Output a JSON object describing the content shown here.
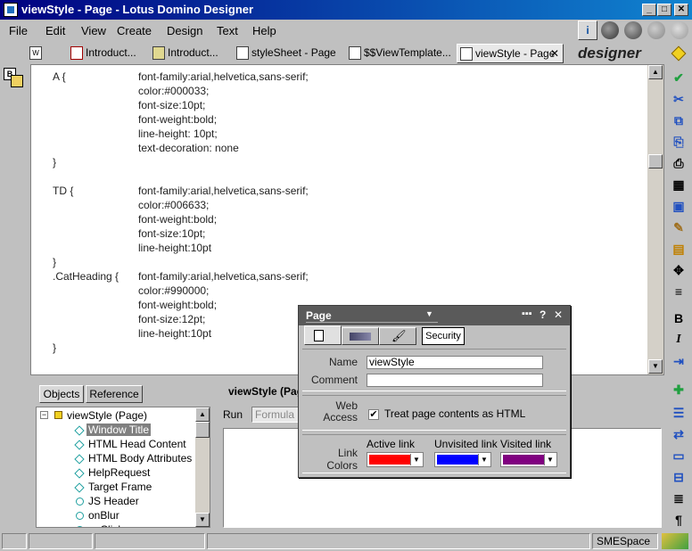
{
  "window": {
    "title": "viewStyle - Page - Lotus Domino Designer"
  },
  "menu": [
    "File",
    "Edit",
    "View",
    "Create",
    "Design",
    "Text",
    "Help"
  ],
  "tabs": [
    {
      "label": "Introduct..."
    },
    {
      "label": "Introduct..."
    },
    {
      "label": "styleSheet - Page"
    },
    {
      "label": "$$ViewTemplate..."
    },
    {
      "label": "viewStyle - Page"
    }
  ],
  "brand": "designer",
  "code_lines": [
    "A {",
    "font-family:arial,helvetica,sans-serif;",
    "color:#000033;",
    "font-size:10pt;",
    "font-weight:bold;",
    "line-height: 10pt;",
    "text-decoration: none",
    "}",
    "TD {",
    "font-family:arial,helvetica,sans-serif;",
    "color:#006633;",
    "font-weight:bold;",
    "font-size:10pt;",
    "line-height:10pt",
    "}",
    ".CatHeading {",
    "font-family:arial,helvetica,sans-serif;",
    "color:#990000;",
    "font-weight:bold;",
    "font-size:12pt;",
    "line-height:10pt",
    "}"
  ],
  "objects_panel": {
    "tabs": [
      "Objects",
      "Reference"
    ],
    "root": "viewStyle (Page)",
    "items": [
      "Window Title",
      "HTML Head Content",
      "HTML Body Attributes",
      "HelpRequest",
      "Target Frame",
      "JS Header",
      "onBlur",
      "onClick"
    ]
  },
  "script_panel": {
    "title": "viewStyle (Page)",
    "run_label": "Run",
    "run_value": "Formula"
  },
  "properties": {
    "title": "Page",
    "security_tab": "Security",
    "name_label": "Name",
    "name_value": "viewStyle",
    "comment_label": "Comment",
    "comment_value": "",
    "web_access_label": "Web Access",
    "treat_html_label": "Treat page contents as HTML",
    "treat_html_checked": true,
    "link_colors_label": "Link Colors",
    "active_link_label": "Active link",
    "unvisited_link_label": "Unvisited link",
    "visited_link_label": "Visited link",
    "active_link_color": "#ff0000",
    "unvisited_link_color": "#0000ff",
    "visited_link_color": "#800080"
  },
  "status": {
    "location": "SMESpace"
  }
}
